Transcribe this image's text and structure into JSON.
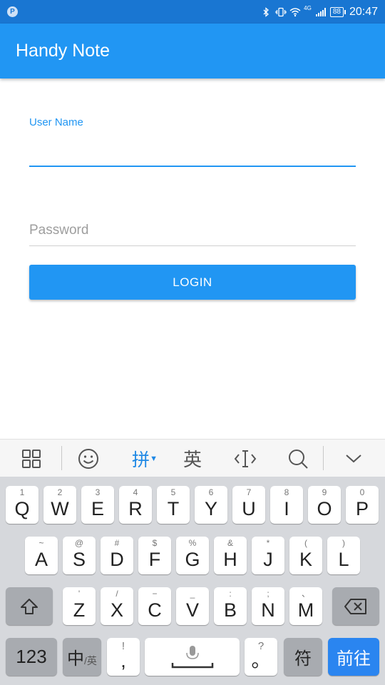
{
  "status_bar": {
    "time": "20:47",
    "battery": "88",
    "network": "4G"
  },
  "app": {
    "title": "Handy Note"
  },
  "form": {
    "username_label": "User Name",
    "username_value": "",
    "password_placeholder": "Password",
    "password_value": "",
    "login_label": "LOGIN"
  },
  "keyboard": {
    "toolbar": {
      "pinyin_label": "拼",
      "english_label": "英"
    },
    "row1": [
      {
        "sub": "1",
        "main": "Q"
      },
      {
        "sub": "2",
        "main": "W"
      },
      {
        "sub": "3",
        "main": "E"
      },
      {
        "sub": "4",
        "main": "R"
      },
      {
        "sub": "5",
        "main": "T"
      },
      {
        "sub": "6",
        "main": "Y"
      },
      {
        "sub": "7",
        "main": "U"
      },
      {
        "sub": "8",
        "main": "I"
      },
      {
        "sub": "9",
        "main": "O"
      },
      {
        "sub": "0",
        "main": "P"
      }
    ],
    "row2": [
      {
        "sub": "~",
        "main": "A"
      },
      {
        "sub": "@",
        "main": "S"
      },
      {
        "sub": "#",
        "main": "D"
      },
      {
        "sub": "$",
        "main": "F"
      },
      {
        "sub": "%",
        "main": "G"
      },
      {
        "sub": "&",
        "main": "H"
      },
      {
        "sub": "*",
        "main": "J"
      },
      {
        "sub": "(",
        "main": "K"
      },
      {
        "sub": ")",
        "main": "L"
      }
    ],
    "row3": [
      {
        "sub": "'",
        "main": "Z"
      },
      {
        "sub": "/",
        "main": "X"
      },
      {
        "sub": "−",
        "main": "C"
      },
      {
        "sub": "_",
        "main": "V"
      },
      {
        "sub": ":",
        "main": "B"
      },
      {
        "sub": ";",
        "main": "N"
      },
      {
        "sub": "、",
        "main": "M"
      }
    ],
    "numbers_key": "123",
    "lang_key_main": "中",
    "lang_key_sub": "/英",
    "comma_key_sub": "!",
    "comma_key_main": ",",
    "period_key_sub": "?",
    "period_key_main": "。",
    "symbol_key": "符",
    "enter_key": "前往"
  }
}
